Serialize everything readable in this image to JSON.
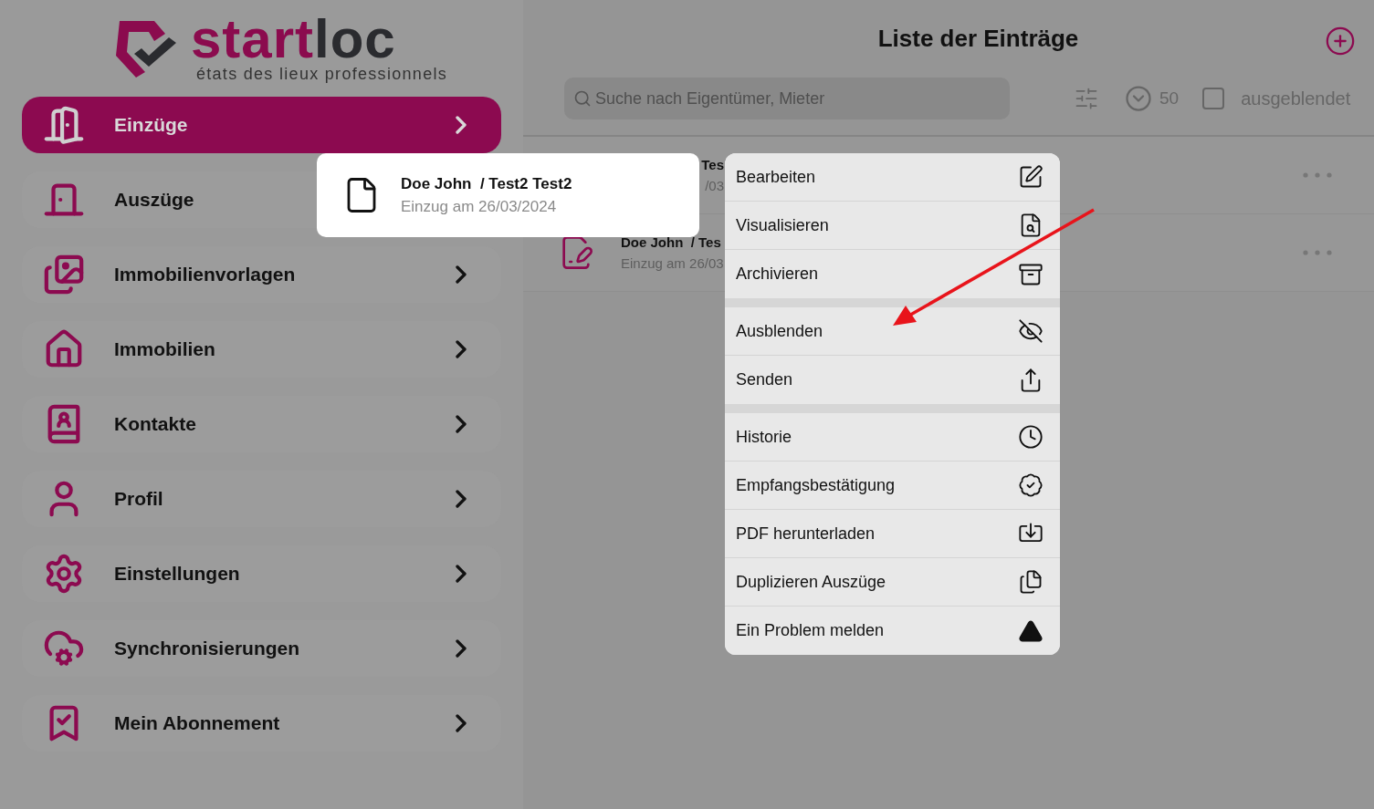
{
  "logo": {
    "brand_start": "start",
    "brand_end": "loc",
    "tagline": "états des lieux professionnels"
  },
  "nav": [
    {
      "label": "Einzüge",
      "selected": true,
      "chevron": true
    },
    {
      "label": "Auszüge",
      "selected": false,
      "chevron": false
    },
    {
      "label": "Immobilienvorlagen",
      "selected": false,
      "chevron": true
    },
    {
      "label": "Immobilien",
      "selected": false,
      "chevron": true
    },
    {
      "label": "Kontakte",
      "selected": false,
      "chevron": true
    },
    {
      "label": "Profil",
      "selected": false,
      "chevron": true
    },
    {
      "label": "Einstellungen",
      "selected": false,
      "chevron": true
    },
    {
      "label": "Synchronisierungen",
      "selected": false,
      "chevron": true
    },
    {
      "label": "Mein Abonnement",
      "selected": false,
      "chevron": true
    }
  ],
  "header": {
    "title": "Liste der Einträge"
  },
  "toolbar": {
    "search": {
      "placeholder": "Suche nach Eigentümer, Mieter"
    },
    "page_size": "50",
    "hidden_filter": {
      "label": "ausgeblendet",
      "checked": false
    }
  },
  "rows": [
    {
      "title": "Tes",
      "subtitle": "/03",
      "kind": "lifted"
    },
    {
      "title": "Doe John  / Tes",
      "subtitle": "Einzug am 26/03",
      "kind": "entry"
    }
  ],
  "lifted_card": {
    "title": "Doe John  / Test2 Test2",
    "subtitle": "Einzug am 26/03/2024"
  },
  "menu": [
    [
      "Bearbeiten",
      "Visualisieren",
      "Archivieren"
    ],
    [
      "Ausblenden",
      "Senden"
    ],
    [
      "Historie",
      "Empfangsbestätigung",
      "PDF herunterladen",
      "Duplizieren Auszüge",
      "Ein Problem melden"
    ]
  ]
}
